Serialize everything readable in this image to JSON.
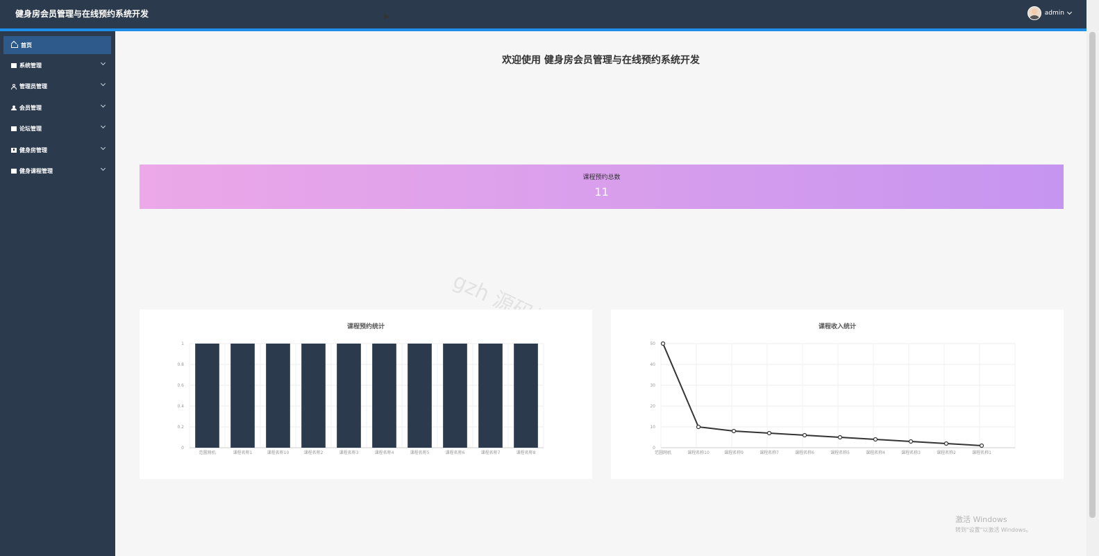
{
  "header": {
    "title": "健身房会员管理与在线预约系统开发",
    "user": "admin"
  },
  "sidebar": {
    "items": [
      {
        "label": "首页",
        "icon": "home-icon",
        "active": true
      },
      {
        "label": "系统管理",
        "icon": "folder-icon",
        "active": false
      },
      {
        "label": "管理员管理",
        "icon": "user-outline-icon",
        "active": false
      },
      {
        "label": "会员管理",
        "icon": "person-icon",
        "active": false
      },
      {
        "label": "论坛管理",
        "icon": "forum-icon",
        "active": false
      },
      {
        "label": "健身房管理",
        "icon": "book-icon",
        "active": false
      },
      {
        "label": "健身课程管理",
        "icon": "course-icon",
        "active": false
      }
    ]
  },
  "main": {
    "welcome": "欢迎使用 健身房会员管理与在线预约系统开发",
    "stat": {
      "label": "课程预约总数",
      "value": "11"
    },
    "watermark": "gzh 源码好优多"
  },
  "chart_data": [
    {
      "type": "bar",
      "title": "课程预约统计",
      "categories": [
        "范圆网机",
        "课程名称1",
        "课程名称10",
        "课程名称2",
        "课程名称3",
        "课程名称4",
        "课程名称5",
        "课程名称6",
        "课程名称7",
        "课程名称8"
      ],
      "values": [
        1,
        1,
        1,
        1,
        1,
        1,
        1,
        1,
        1,
        1
      ],
      "yticks": [
        "0",
        "0.2",
        "0.4",
        "0.6",
        "0.8",
        "1"
      ],
      "ylim": [
        0,
        1
      ],
      "color": "#2c3a4d",
      "grid": true
    },
    {
      "type": "line",
      "title": "课程收入统计",
      "categories": [
        "范圆网机",
        "课程名称10",
        "课程名称9",
        "课程名称7",
        "课程名称6",
        "课程名称5",
        "课程名称4",
        "课程名称3",
        "课程名称2",
        "课程名称1"
      ],
      "values": [
        50,
        10,
        8,
        7,
        6,
        5,
        4,
        3,
        2,
        1
      ],
      "yticks": [
        "0",
        "10",
        "20",
        "30",
        "40",
        "50"
      ],
      "ylim": [
        0,
        50
      ],
      "color": "#333333",
      "grid": true
    }
  ],
  "os_overlay": {
    "line1": "激活 Windows",
    "line2": "转到\"设置\"以激活 Windows。"
  }
}
